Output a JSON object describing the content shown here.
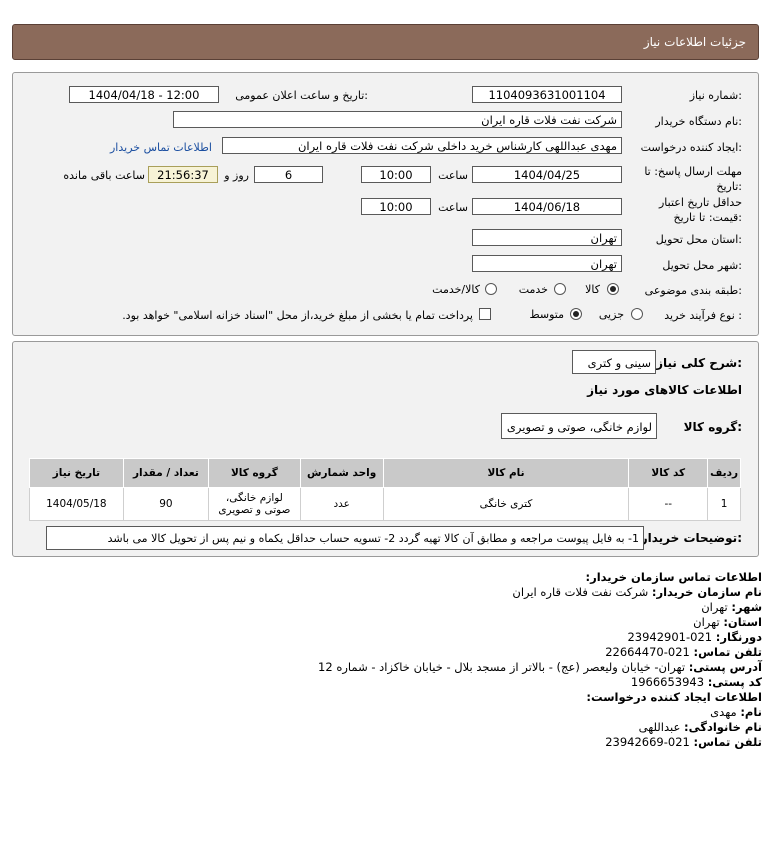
{
  "header": {
    "title": "جزئیات اطلاعات نیاز"
  },
  "form": {
    "need_number_label": "شماره نیاز:",
    "need_number": "1104093631001104",
    "announce_label": "تاریخ و ساعت اعلان عمومی:",
    "announce_value": "1404/04/18 - 12:00",
    "buyer_org_label": "نام دستگاه خریدار:",
    "buyer_org": "شرکت نفت فلات قاره ایران",
    "creator_label": "ایجاد کننده درخواست:",
    "creator": "مهدی عبداللهی کارشناس خرید داخلی شرکت نفت فلات قاره ایران",
    "contact_link": "اطلاعات تماس خریدار",
    "deadline_label": "مهلت ارسال پاسخ: تا تاریخ:",
    "deadline_date": "1404/04/25",
    "time_label": "ساعت",
    "deadline_time": "10:00",
    "days_value": "6",
    "days_label": "روز و",
    "remaining_time": "21:56:37",
    "remaining_label": "ساعت باقی مانده",
    "validity_label": "حداقل تاریخ اعتبار قیمت: تا تاریخ:",
    "validity_date": "1404/06/18",
    "validity_time": "10:00",
    "province_label": "استان محل تحویل:",
    "province": "تهران",
    "city_label": "شهر محل تحویل:",
    "city": "تهران",
    "category_label": "طبقه بندی موضوعی:",
    "category_options": [
      "کالا",
      "خدمت",
      "کالا/خدمت"
    ],
    "category_selected": "کالا",
    "process_label": "نوع فرآیند خرید :",
    "process_options": [
      "جزیی",
      "متوسط"
    ],
    "process_selected": "متوسط",
    "payment_note": "پرداخت تمام یا بخشی از مبلغ خرید،از محل \"اسناد خزانه اسلامی\" خواهد بود."
  },
  "details": {
    "summary_label": "شرح کلی نیاز:",
    "summary": "سینی و کتری",
    "goods_info_title": "اطلاعات کالاهای مورد نیاز",
    "group_label": "گروه کالا:",
    "group": "لوازم خانگی، صوتی و تصویری",
    "table": {
      "headers": [
        "ردیف",
        "کد کالا",
        "نام کالا",
        "واحد شمارش",
        "گروه کالا",
        "تعداد / مقدار",
        "تاریخ نیاز"
      ],
      "rows": [
        [
          "1",
          "--",
          "کتری خانگی",
          "عدد",
          "لوازم خانگی، صوتی و تصویری",
          "90",
          "1404/05/18"
        ]
      ]
    },
    "buyer_notes_label": "توضیحات خریدار:",
    "buyer_notes": "1- به فایل پیوست مراجعه و مطابق آن کالا تهیه گردد 2- تسویه حساب حداقل یکماه و نیم پس از تحویل کالا می باشد"
  },
  "contact": {
    "org_title": "اطلاعات تماس سازمان خریدار:",
    "buyer_name_label": "نام سازمان خریدار:",
    "buyer_name": "شرکت نفت فلات قاره ایران",
    "city_label": "شهر:",
    "city": "تهران",
    "province_label": "استان:",
    "province": "تهران",
    "fax_label": "دورنگار:",
    "fax": "021-23942901",
    "phone_label": "تلفن تماس:",
    "phone": "021-22664470",
    "address_label": "آدرس پستی:",
    "address": "تهران- خیابان ولیعصر (عج) - بالاتر از مسجد بلال - خیابان خاکزاد - شماره 12",
    "postal_label": "کد پستی:",
    "postal": "1966653943",
    "creator_title": "اطلاعات ایجاد کننده درخواست:",
    "first_name_label": "نام:",
    "first_name": "مهدی",
    "last_name_label": "نام خانوادگی:",
    "last_name": "عبداللهی",
    "creator_phone_label": "تلفن تماس:",
    "creator_phone": "021-23942669"
  }
}
